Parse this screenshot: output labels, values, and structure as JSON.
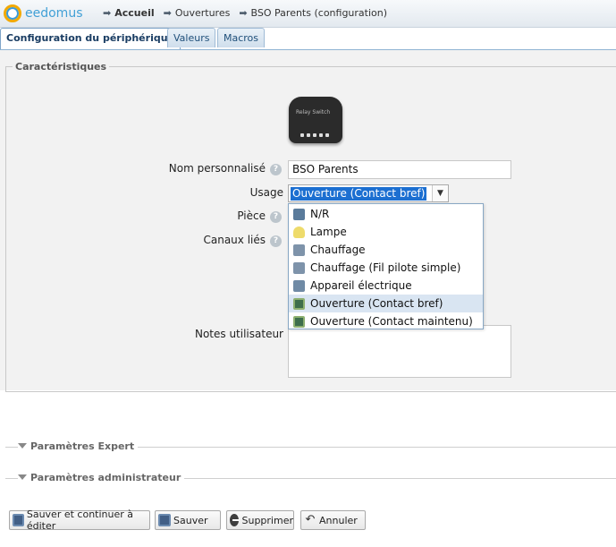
{
  "app": {
    "logo_text": "eedomus",
    "brand_color": "#41a0d6"
  },
  "breadcrumb": [
    "Accueil",
    "Ouvertures",
    "BSO Parents (configuration)"
  ],
  "tabs": [
    "Configuration du périphérique",
    "Valeurs",
    "Macros"
  ],
  "section_title": "Caractéristiques",
  "device_image_label": "Relay Switch",
  "form": {
    "name_label": "Nom personnalisé",
    "name_value": "BSO Parents",
    "usage_label": "Usage",
    "usage_value": "Ouverture (Contact bref)",
    "piece_label": "Pièce",
    "canaux_label": "Canaux liés",
    "notes_label": "Notes utilisateur"
  },
  "usage_options": [
    {
      "label": "N/R",
      "icon": "na-icon"
    },
    {
      "label": "Lampe",
      "icon": "lamp-icon"
    },
    {
      "label": "Chauffage",
      "icon": "heater-icon"
    },
    {
      "label": "Chauffage (Fil pilote simple)",
      "icon": "heater-icon"
    },
    {
      "label": "Appareil électrique",
      "icon": "plug-icon"
    },
    {
      "label": "Ouverture (Contact bref)",
      "icon": "opening-icon",
      "selected": true
    },
    {
      "label": "Ouverture (Contact maintenu)",
      "icon": "opening-icon"
    }
  ],
  "collapsed_sections": [
    "Paramètres Expert",
    "Paramètres administrateur"
  ],
  "buttons": {
    "save_continue": "Sauver et continuer à éditer",
    "save": "Sauver",
    "delete": "Supprimer",
    "cancel": "Annuler"
  },
  "help_glyph": "?"
}
